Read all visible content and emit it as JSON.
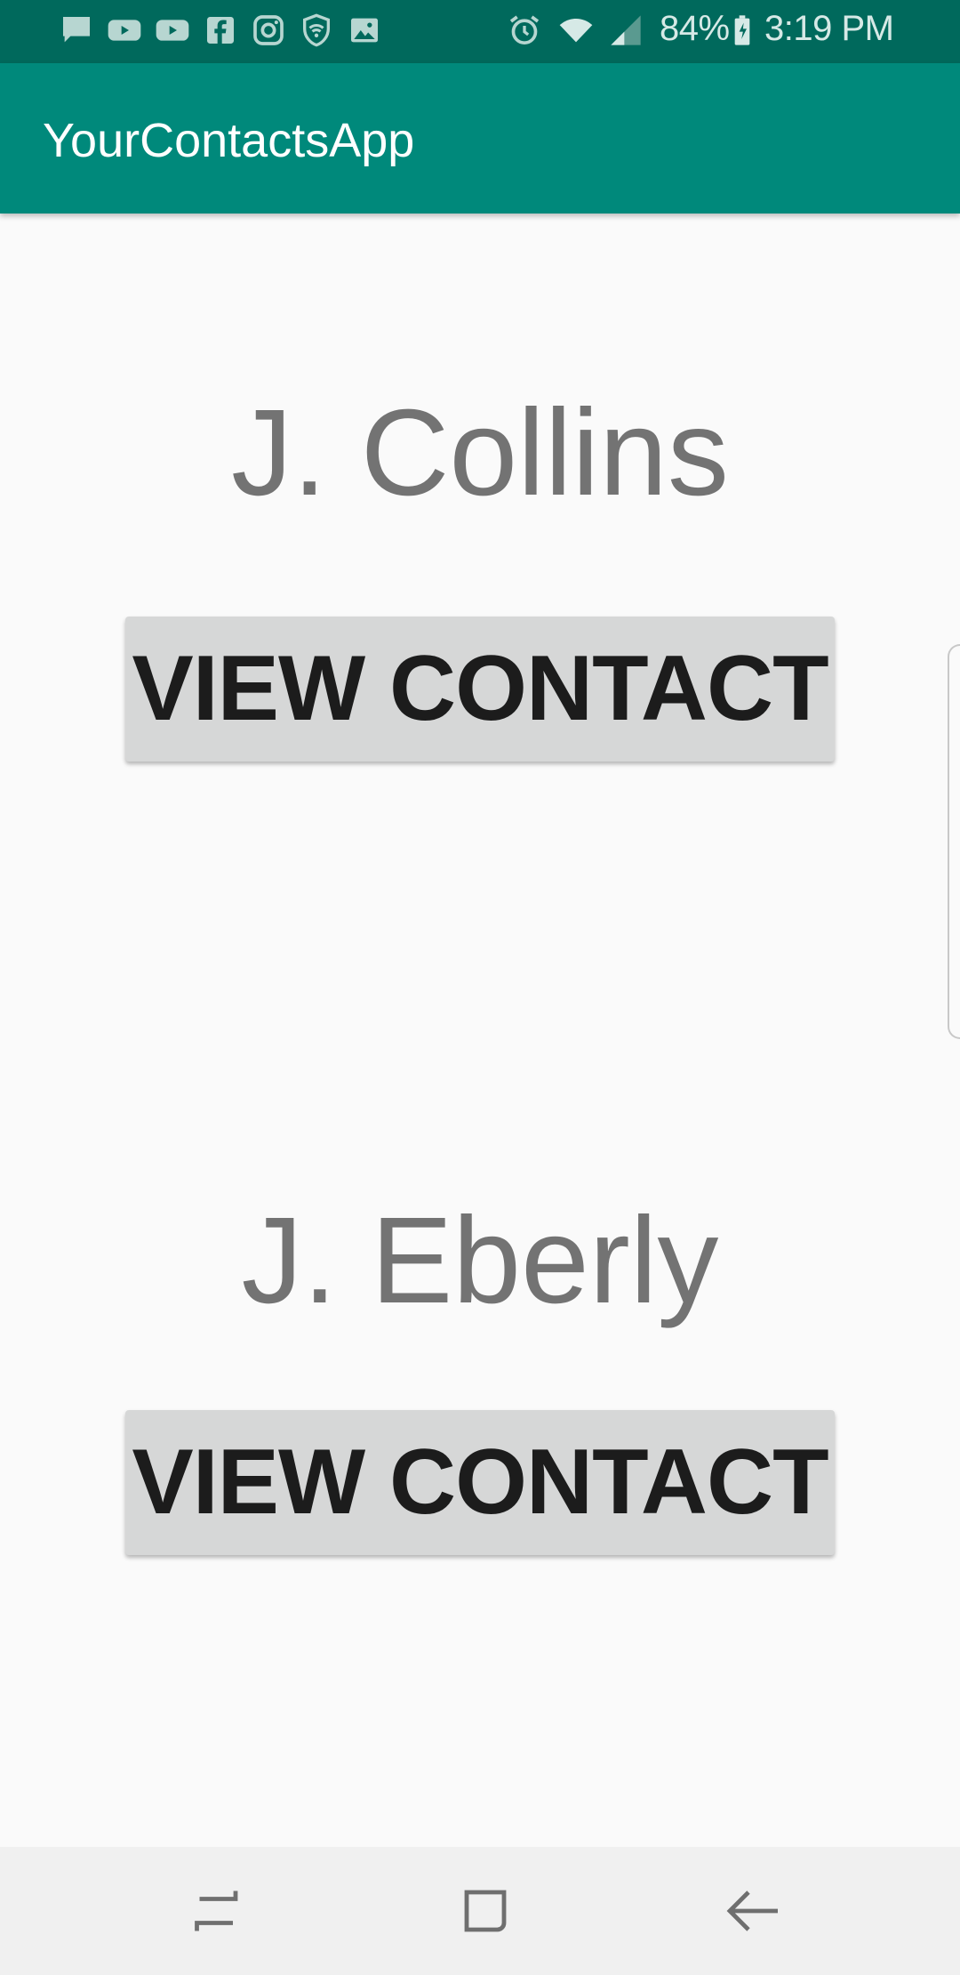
{
  "status_bar": {
    "icons_left": [
      "message-icon",
      "youtube-icon",
      "youtube-icon",
      "facebook-icon",
      "instagram-icon",
      "shield-wifi-icon",
      "image-icon"
    ],
    "icons_right": [
      "alarm-icon",
      "wifi-icon",
      "signal-icon",
      "battery-charging-icon"
    ],
    "battery": "84%",
    "time": "3:19 PM",
    "bg_color": "#00695c"
  },
  "app_bar": {
    "title": "YourContactsApp",
    "bg_color": "#00897b"
  },
  "contacts": [
    {
      "name": "J. Collins",
      "button_label": "VIEW CONTACT"
    },
    {
      "name": "J. Eberly",
      "button_label": "VIEW CONTACT"
    }
  ],
  "nav_bar": {
    "buttons": [
      "recent-apps-icon",
      "home-icon",
      "back-icon"
    ]
  }
}
